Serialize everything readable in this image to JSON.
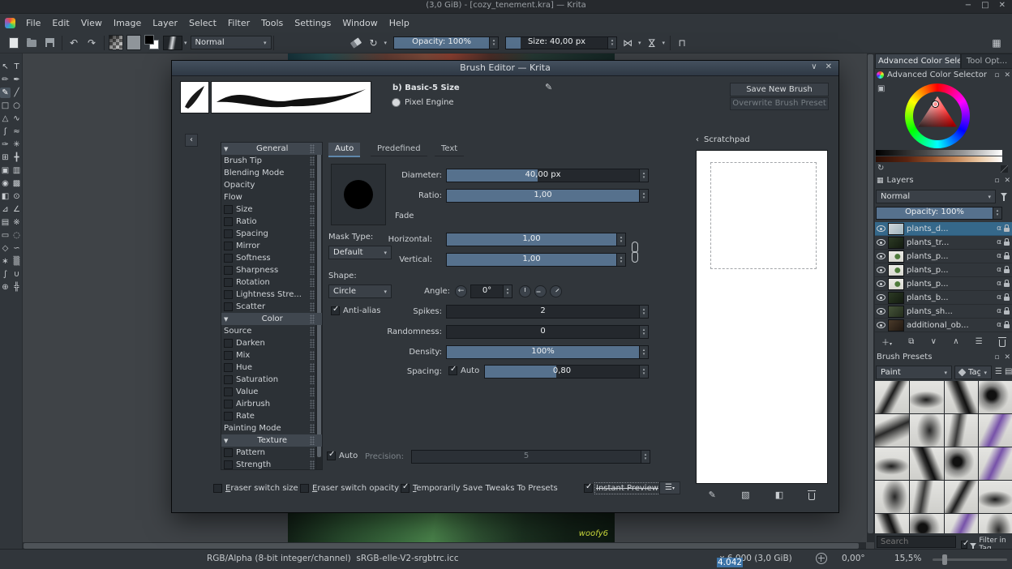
{
  "window": {
    "title": "(3,0 GiB) - [cozy_tenement.kra] — Krita"
  },
  "menubar": {
    "items": [
      "File",
      "Edit",
      "View",
      "Image",
      "Layer",
      "Select",
      "Filter",
      "Tools",
      "Settings",
      "Window",
      "Help"
    ]
  },
  "toolbar": {
    "blending_mode": "Normal",
    "opacity": "Opacity: 100%",
    "size": "Size: 40,00 px"
  },
  "toolbox": {
    "tools": [
      {
        "name": "select-shapes",
        "glyph": "↖"
      },
      {
        "name": "text",
        "glyph": "T"
      },
      {
        "name": "edit-shapes",
        "glyph": "✏"
      },
      {
        "name": "calligraphy",
        "glyph": "✒"
      },
      {
        "name": "freehand-brush",
        "glyph": "✎",
        "active": true
      },
      {
        "name": "line",
        "glyph": "╱"
      },
      {
        "name": "rectangle",
        "glyph": "□"
      },
      {
        "name": "ellipse",
        "glyph": "○"
      },
      {
        "name": "polygon",
        "glyph": "△"
      },
      {
        "name": "polyline",
        "glyph": "∿"
      },
      {
        "name": "bezier-curve",
        "glyph": "ʃ"
      },
      {
        "name": "freehand-path",
        "glyph": "≈"
      },
      {
        "name": "dynamic-brush",
        "glyph": "✑"
      },
      {
        "name": "multibrush",
        "glyph": "✳"
      },
      {
        "name": "transform",
        "glyph": "⊞"
      },
      {
        "name": "move",
        "glyph": "╋"
      },
      {
        "name": "crop",
        "glyph": "▣"
      },
      {
        "name": "gradient",
        "glyph": "▥"
      },
      {
        "name": "color-sampler",
        "glyph": "◉"
      },
      {
        "name": "pattern",
        "glyph": "▩"
      },
      {
        "name": "fill",
        "glyph": "◧"
      },
      {
        "name": "enclose-fill",
        "glyph": "⊙"
      },
      {
        "name": "assistants",
        "glyph": "⊿"
      },
      {
        "name": "measure",
        "glyph": "∠"
      },
      {
        "name": "reference-images",
        "glyph": "▤"
      },
      {
        "name": "smart-patch",
        "glyph": "※"
      },
      {
        "name": "select-rectangular",
        "glyph": "▭"
      },
      {
        "name": "select-elliptical",
        "glyph": "◌"
      },
      {
        "name": "select-polygonal",
        "glyph": "◇"
      },
      {
        "name": "select-freehand",
        "glyph": "∽"
      },
      {
        "name": "select-similar",
        "glyph": "∗"
      },
      {
        "name": "select-contiguous",
        "glyph": "▒"
      },
      {
        "name": "select-bezier",
        "glyph": "∫"
      },
      {
        "name": "select-magnetic",
        "glyph": "∪"
      },
      {
        "name": "zoom",
        "glyph": "⊕"
      },
      {
        "name": "pan",
        "glyph": "╬"
      }
    ]
  },
  "canvas": {
    "signature": "woofy6"
  },
  "brush_editor": {
    "title": "Brush Editor — Krita",
    "preset_name": "b) Basic-5 Size",
    "engine": "Pixel Engine",
    "save_button": "Save New Brush Preset...",
    "overwrite_button": "Overwrite Brush Preset",
    "options": [
      {
        "label": "General",
        "sec": true
      },
      {
        "label": "Brush Tip"
      },
      {
        "label": "Blending Mode"
      },
      {
        "label": "Opacity"
      },
      {
        "label": "Flow"
      },
      {
        "label": "Size",
        "cb": true,
        "on": true
      },
      {
        "label": "Ratio",
        "cb": true
      },
      {
        "label": "Spacing",
        "cb": true
      },
      {
        "label": "Mirror",
        "cb": true
      },
      {
        "label": "Softness",
        "cb": true
      },
      {
        "label": "Sharpness",
        "cb": true
      },
      {
        "label": "Rotation",
        "cb": true
      },
      {
        "label": "Lightness Stre...",
        "cb": true
      },
      {
        "label": "Scatter",
        "cb": true
      },
      {
        "label": "Color",
        "sec": true
      },
      {
        "label": "Source"
      },
      {
        "label": "Darken",
        "cb": true
      },
      {
        "label": "Mix",
        "cb": true
      },
      {
        "label": "Hue",
        "cb": true
      },
      {
        "label": "Saturation",
        "cb": true
      },
      {
        "label": "Value",
        "cb": true
      },
      {
        "label": "Airbrush",
        "cb": true
      },
      {
        "label": "Rate",
        "cb": true
      },
      {
        "label": "Painting Mode"
      },
      {
        "label": "Texture",
        "sec": true
      },
      {
        "label": "Pattern",
        "cb": true
      },
      {
        "label": "Strength",
        "cb": true
      }
    ],
    "tabs": {
      "auto": "Auto",
      "predefined": "Predefined",
      "text": "Text"
    },
    "fields": {
      "diameter_label": "Diameter:",
      "diameter_value": "40,00 px",
      "ratio_label": "Ratio:",
      "ratio_value": "1,00",
      "fade_label": "Fade",
      "horizontal_label": "Horizontal:",
      "horizontal_value": "1,00",
      "vertical_label": "Vertical:",
      "vertical_value": "1,00",
      "mask_type_label": "Mask Type:",
      "mask_type_value": "Default",
      "shape_label": "Shape:",
      "shape_value": "Circle",
      "angle_label": "Angle:",
      "angle_value": "0°",
      "antialias_label": "Anti-alias",
      "spikes_label": "Spikes:",
      "spikes_value": "2",
      "randomness_label": "Randomness:",
      "randomness_value": "0",
      "density_label": "Density:",
      "density_value": "100%",
      "spacing_label": "Spacing:",
      "spacing_auto": "Auto",
      "spacing_value": "0,80",
      "auto_label": "Auto",
      "precision_label": "Precision:",
      "precision_value": "5"
    },
    "footer": {
      "eraser_switch_size": "Eraser switch size",
      "eraser_switch_opacity": "Eraser switch opacity",
      "save_tweaks": "Temporarily Save Tweaks To Presets",
      "instant_preview": "Instant Preview"
    },
    "scratchpad_title": "Scratchpad"
  },
  "dock": {
    "tab_color": "Advanced Color Sele...",
    "tab_tool": "Tool Opt...",
    "color_selector_title": "Advanced Color Selector",
    "layers": {
      "title": "Layers",
      "blending_mode": "Normal",
      "opacity": "Opacity: 100%",
      "alpha_badge": "α",
      "rows": [
        {
          "name": "plants_d...",
          "selected": true
        },
        {
          "name": "plants_tr..."
        },
        {
          "name": "plants_p..."
        },
        {
          "name": "plants_p..."
        },
        {
          "name": "plants_p..."
        },
        {
          "name": "plants_b..."
        },
        {
          "name": "plants_sh..."
        },
        {
          "name": "additional_ob..."
        }
      ]
    },
    "presets": {
      "title": "Brush Presets",
      "paint": "Paint",
      "tag": "Tag",
      "search_placeholder": "Search",
      "filter_label": "Filter in Tag"
    }
  },
  "statusbar": {
    "profile": "RGB/Alpha (8-bit integer/channel)  sRGB-elle-V2-srgbtrc.icc",
    "dim_selected": "4.042",
    "dim_rest": " x 6.000 (3,0 GiB)",
    "angle": "0,00°",
    "zoom": "15,5%"
  }
}
